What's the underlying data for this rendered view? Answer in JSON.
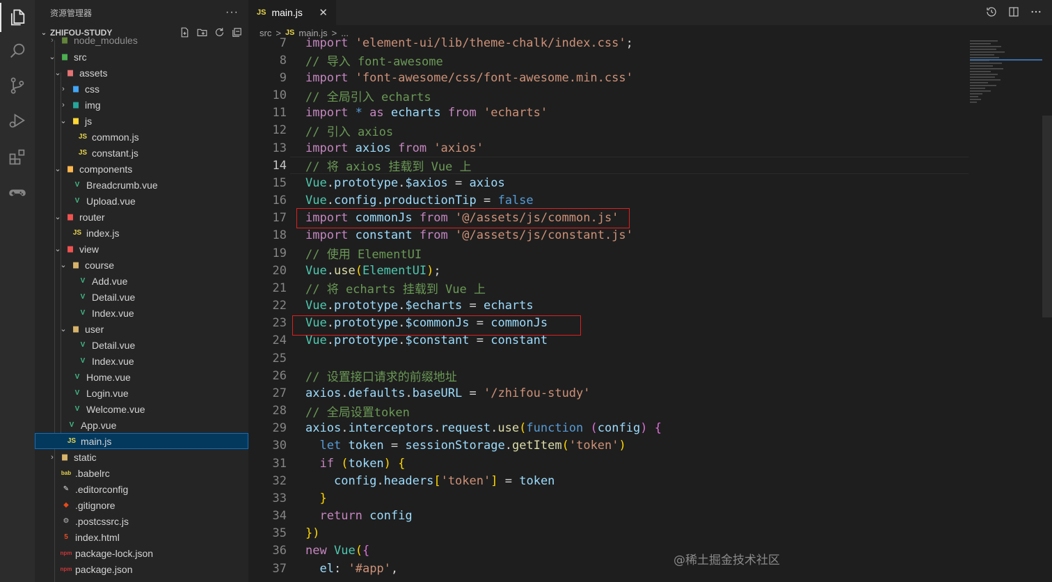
{
  "sidebar": {
    "title": "资源管理器",
    "more": "···",
    "project": "ZHIFOU-STUDY",
    "items": [
      {
        "label": "node_modules",
        "icon": "folder-node-icon"
      },
      {
        "label": "src",
        "icon": "folder-src-icon"
      },
      {
        "label": "assets",
        "icon": "folder-assets-icon"
      },
      {
        "label": "css",
        "icon": "folder-css-icon"
      },
      {
        "label": "img",
        "icon": "folder-img-icon"
      },
      {
        "label": "js",
        "icon": "folder-js-icon"
      },
      {
        "label": "common.js",
        "icon": "JS"
      },
      {
        "label": "constant.js",
        "icon": "JS"
      },
      {
        "label": "components",
        "icon": "folder-components-icon"
      },
      {
        "label": "Breadcrumb.vue",
        "icon": "V"
      },
      {
        "label": "Upload.vue",
        "icon": "V"
      },
      {
        "label": "router",
        "icon": "folder-router-icon"
      },
      {
        "label": "index.js",
        "icon": "JS"
      },
      {
        "label": "view",
        "icon": "folder-view-icon"
      },
      {
        "label": "course",
        "icon": "folder-icon"
      },
      {
        "label": "Add.vue",
        "icon": "V"
      },
      {
        "label": "Detail.vue",
        "icon": "V"
      },
      {
        "label": "Index.vue",
        "icon": "V"
      },
      {
        "label": "user",
        "icon": "folder-icon"
      },
      {
        "label": "Detail.vue",
        "icon": "V"
      },
      {
        "label": "Index.vue",
        "icon": "V"
      },
      {
        "label": "Home.vue",
        "icon": "V"
      },
      {
        "label": "Login.vue",
        "icon": "V"
      },
      {
        "label": "Welcome.vue",
        "icon": "V"
      },
      {
        "label": "App.vue",
        "icon": "V"
      },
      {
        "label": "main.js",
        "icon": "JS"
      },
      {
        "label": "static",
        "icon": "folder-icon"
      },
      {
        "label": ".babelrc",
        "icon": "babel-icon"
      },
      {
        "label": ".editorconfig",
        "icon": "editorconfig-icon"
      },
      {
        "label": ".gitignore",
        "icon": "git-icon"
      },
      {
        "label": ".postcssrc.js",
        "icon": "postcss-icon"
      },
      {
        "label": "index.html",
        "icon": "html-icon"
      },
      {
        "label": "package-lock.json",
        "icon": "npm-icon"
      },
      {
        "label": "package.json",
        "icon": "npm-icon"
      }
    ]
  },
  "editor": {
    "tab": {
      "icon": "JS",
      "label": "main.js",
      "close": "✕"
    },
    "breadcrumb": {
      "folder": "src",
      "sep": ">",
      "icon": "JS",
      "file": "main.js",
      "tail": "..."
    },
    "current_line": 14,
    "lines": [
      {
        "n": 7,
        "text": "import 'element-ui/lib/theme-chalk/index.css';"
      },
      {
        "n": 8,
        "text": "// 导入 font-awesome"
      },
      {
        "n": 9,
        "text": "import 'font-awesome/css/font-awesome.min.css'"
      },
      {
        "n": 10,
        "text": "// 全局引入 echarts"
      },
      {
        "n": 11,
        "text": "import * as echarts from 'echarts'"
      },
      {
        "n": 12,
        "text": "// 引入 axios"
      },
      {
        "n": 13,
        "text": "import axios from 'axios'"
      },
      {
        "n": 14,
        "text": "// 将 axios 挂载到 Vue 上"
      },
      {
        "n": 15,
        "text": "Vue.prototype.$axios = axios"
      },
      {
        "n": 16,
        "text": "Vue.config.productionTip = false"
      },
      {
        "n": 17,
        "text": "import commonJs from '@/assets/js/common.js'"
      },
      {
        "n": 18,
        "text": "import constant from '@/assets/js/constant.js'"
      },
      {
        "n": 19,
        "text": "// 使用 ElementUI"
      },
      {
        "n": 20,
        "text": "Vue.use(ElementUI);"
      },
      {
        "n": 21,
        "text": "// 将 echarts 挂载到 Vue 上"
      },
      {
        "n": 22,
        "text": "Vue.prototype.$echarts = echarts"
      },
      {
        "n": 23,
        "text": "Vue.prototype.$commonJs = commonJs"
      },
      {
        "n": 24,
        "text": "Vue.prototype.$constant = constant"
      },
      {
        "n": 25,
        "text": ""
      },
      {
        "n": 26,
        "text": "// 设置接口请求的前缀地址"
      },
      {
        "n": 27,
        "text": "axios.defaults.baseURL = '/zhifou-study'"
      },
      {
        "n": 28,
        "text": "// 全局设置token"
      },
      {
        "n": 29,
        "text": "axios.interceptors.request.use(function (config) {"
      },
      {
        "n": 30,
        "text": "  let token = sessionStorage.getItem('token')"
      },
      {
        "n": 31,
        "text": "  if (token) {"
      },
      {
        "n": 32,
        "text": "    config.headers['token'] = token"
      },
      {
        "n": 33,
        "text": "  }"
      },
      {
        "n": 34,
        "text": "  return config"
      },
      {
        "n": 35,
        "text": "})"
      },
      {
        "n": 36,
        "text": "new Vue({"
      },
      {
        "n": 37,
        "text": "  el: '#app',"
      }
    ]
  },
  "watermark": "@稀土掘金技术社区",
  "colors": {
    "highlight_box": "#e02020",
    "js_icon": "#e8d44d",
    "vue_icon": "#41b883",
    "selection": "#04395e"
  }
}
